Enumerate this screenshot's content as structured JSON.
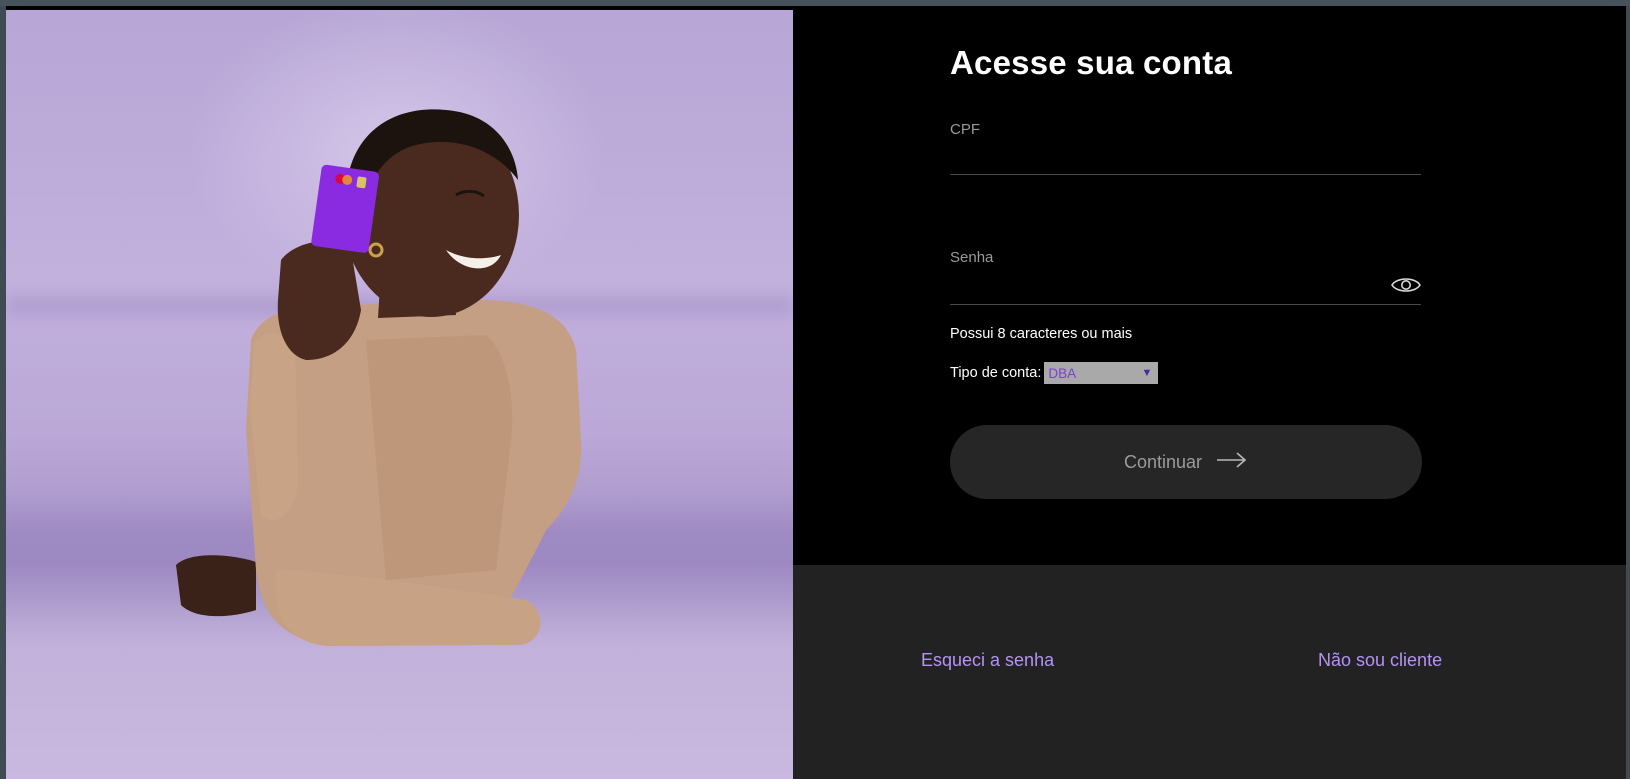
{
  "form": {
    "title": "Acesse sua conta",
    "cpf_label": "CPF",
    "cpf_value": "",
    "senha_label": "Senha",
    "senha_value": "",
    "eye_icon": "eye-icon",
    "password_hint": "Possui 8 caracteres ou mais",
    "account_type_label": "Tipo de conta:",
    "account_type_selected": "DBA",
    "continue_label": "Continuar",
    "continue_icon": "arrow-right-icon"
  },
  "footer": {
    "forgot_password": "Esqueci a senha",
    "not_client": "Não sou cliente"
  },
  "colors": {
    "background": "#000000",
    "footer_background": "#222222",
    "link": "#b592f5",
    "button": "#262626",
    "select_text": "#7a3fd6"
  }
}
